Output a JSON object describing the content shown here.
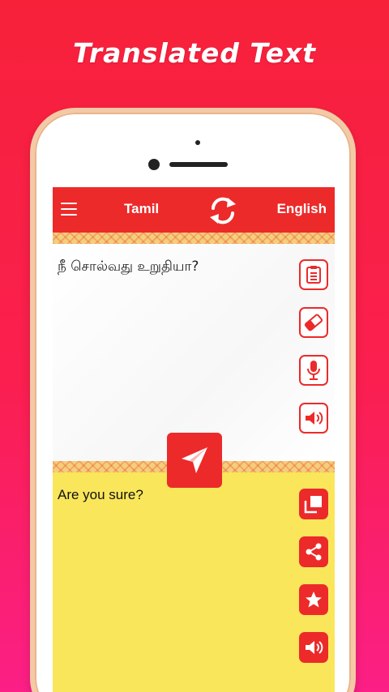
{
  "headline": "Translated Text",
  "appbar": {
    "source_language": "Tamil",
    "target_language": "English"
  },
  "input": {
    "text": "நீ சொல்வது உறுதியா?"
  },
  "output": {
    "text": "Are you sure?"
  },
  "input_actions": [
    "clipboard-icon",
    "eraser-icon",
    "microphone-icon",
    "speaker-icon"
  ],
  "output_actions": [
    "copy-icon",
    "share-icon",
    "star-icon",
    "speaker-icon"
  ],
  "colors": {
    "accent": "#ec2a2a",
    "output_background": "#f9e65a",
    "pattern": "#f4cf7a"
  }
}
